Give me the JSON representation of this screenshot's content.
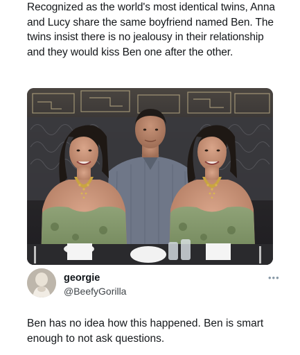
{
  "post": {
    "text": "Recognized as the world's most identical twins, Anna and Lucy share the same boyfriend named Ben. The twins insist there is no jealousy in their relationship and they would kiss Ben one after the other."
  },
  "reply": {
    "display_name": "georgie",
    "handle": "@BeefyGorilla",
    "more_icon": "more-options-icon",
    "text": "Ben has no idea how this happened. Ben is smart enough to not ask questions."
  }
}
